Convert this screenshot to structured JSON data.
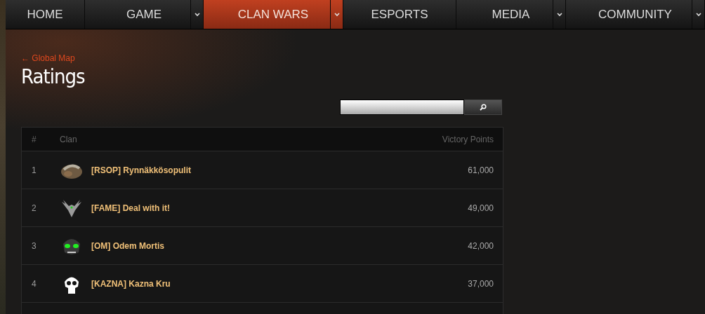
{
  "nav": [
    {
      "label": "HOME",
      "dropdown": false,
      "selected": false
    },
    {
      "label": "GAME",
      "dropdown": true,
      "selected": false
    },
    {
      "label": "CLAN WARS",
      "dropdown": true,
      "selected": true
    },
    {
      "label": "ESPORTS",
      "dropdown": false,
      "selected": false
    },
    {
      "label": "MEDIA",
      "dropdown": true,
      "selected": false
    },
    {
      "label": "COMMUNITY",
      "dropdown": true,
      "selected": false
    }
  ],
  "back_link": "← Global Map",
  "title": "Ratings",
  "table": {
    "columns": [
      "#",
      "Clan",
      "Victory Points"
    ],
    "rows": [
      {
        "rank": "1",
        "kind": "helmet",
        "clan": "[RSOP] Rynnäkkösopulit",
        "points": "61,000"
      },
      {
        "rank": "2",
        "kind": "wings",
        "clan": "[FAME] Deal with it!",
        "points": "49,000"
      },
      {
        "rank": "3",
        "kind": "mask",
        "clan": "[OM] Odem Mortis",
        "points": "42,000"
      },
      {
        "rank": "4",
        "kind": "skull",
        "clan": "[KAZNA] Kazna Kru",
        "points": "37,000"
      }
    ]
  }
}
